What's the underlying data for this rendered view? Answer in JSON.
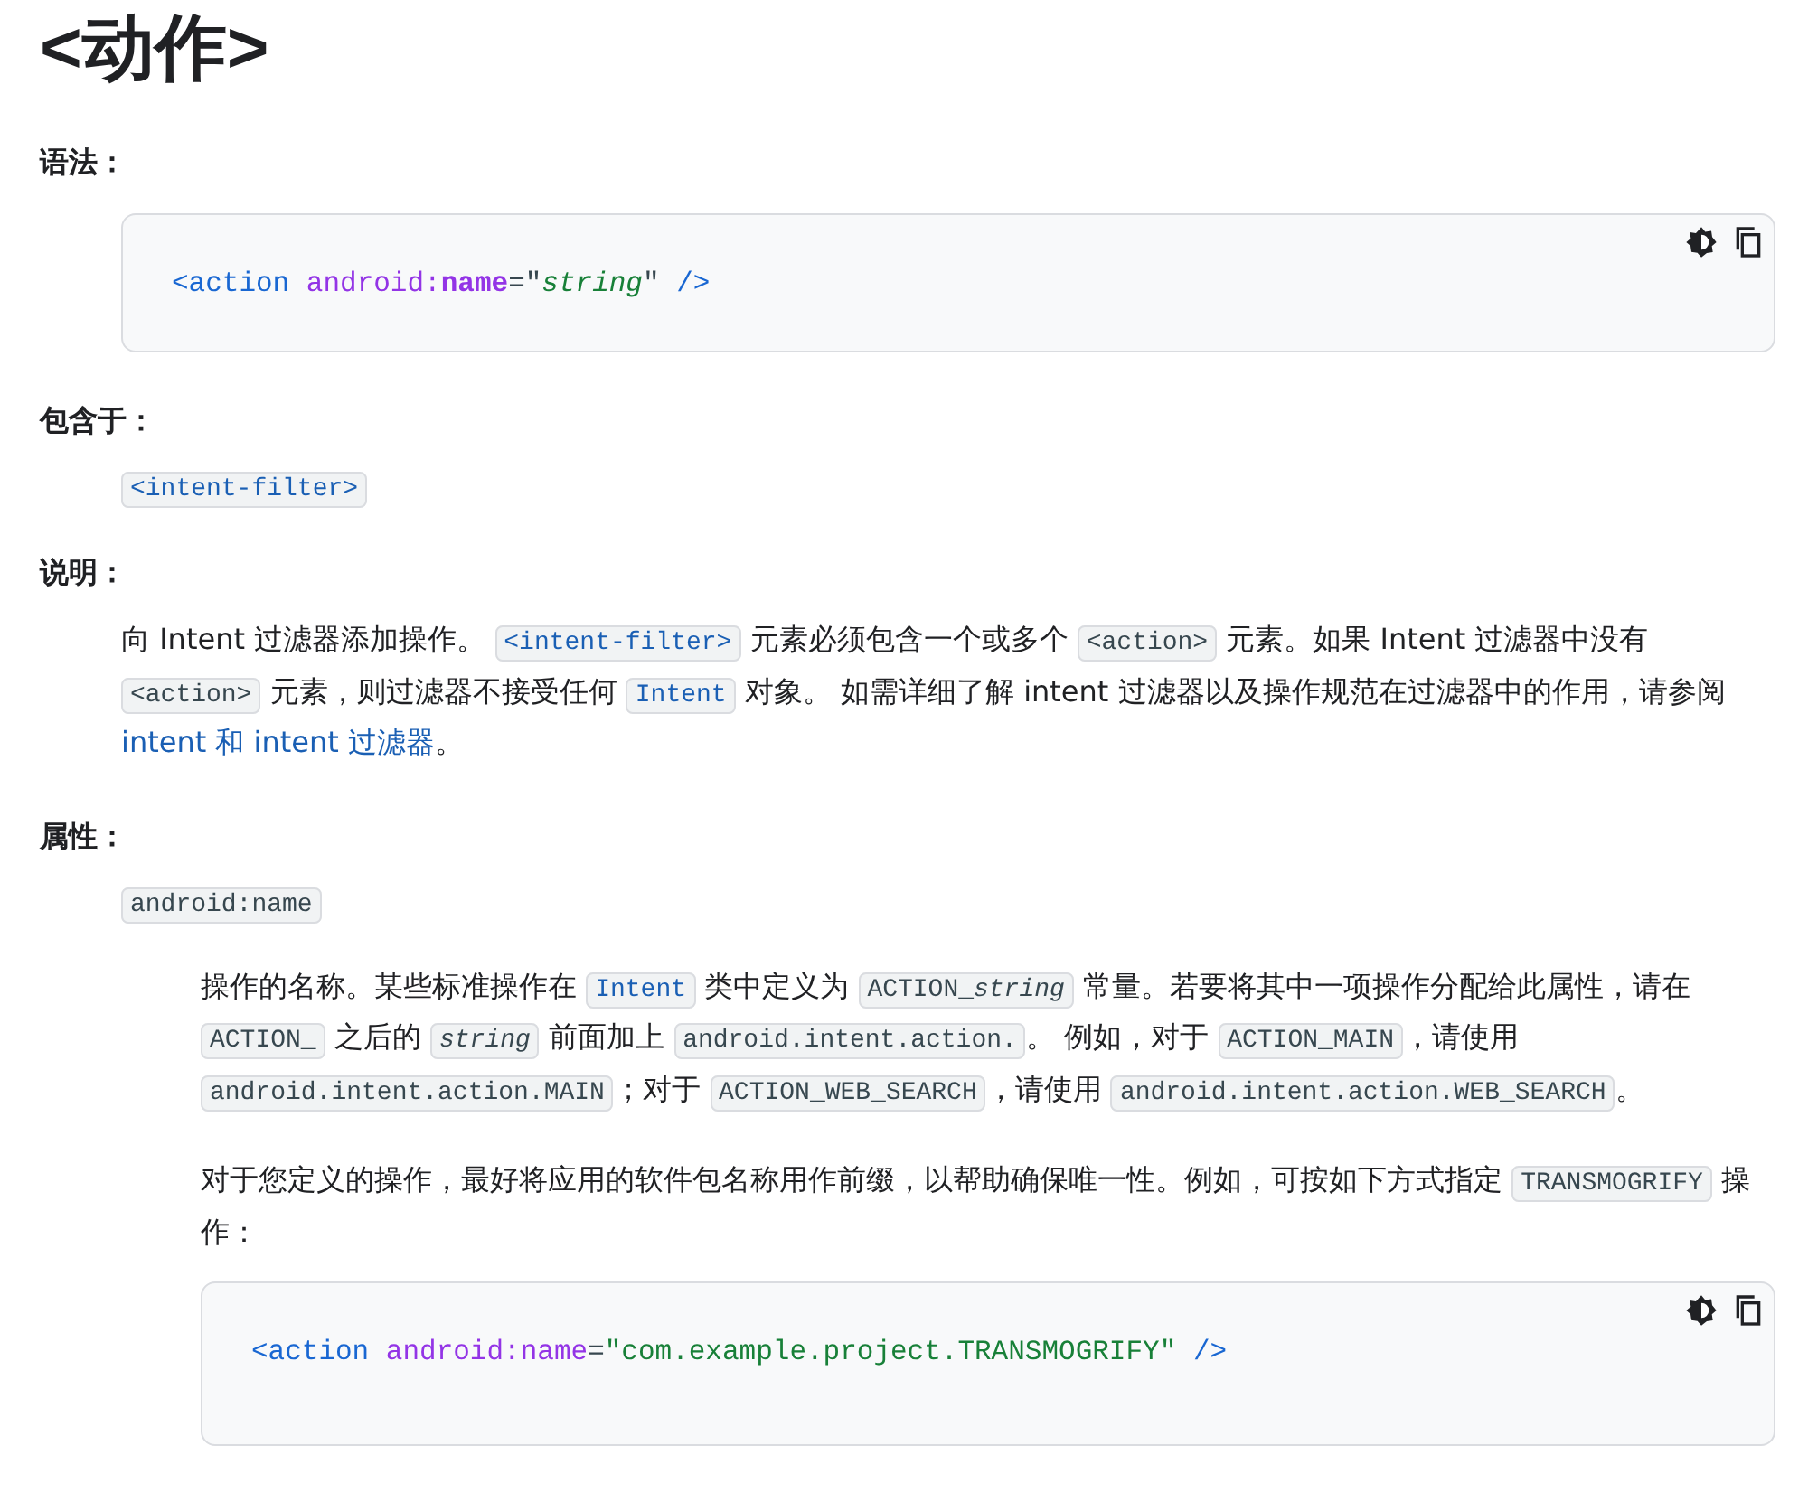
{
  "title": "<动作>",
  "sections": [
    {
      "label": "语法：",
      "blocks": [
        {
          "kind": "codeblock",
          "tokens": [
            {
              "kind": "tag",
              "text": "<action"
            },
            {
              "kind": "ns",
              "text": " android:"
            },
            {
              "kind": "attr",
              "text": "name"
            },
            {
              "kind": "plain",
              "text": "=\""
            },
            {
              "kind": "value_em",
              "text": "string"
            },
            {
              "kind": "plain",
              "text": "\""
            },
            {
              "kind": "tag",
              "text": " />"
            }
          ]
        }
      ]
    },
    {
      "label": "包含于：",
      "blocks": [
        {
          "kind": "chips",
          "items": [
            {
              "kind": "code_link",
              "text": "<intent-filter>"
            }
          ]
        }
      ]
    },
    {
      "label": "说明：",
      "blocks": [
        {
          "kind": "paragraph",
          "segments": [
            {
              "kind": "text",
              "text": "向 Intent 过滤器添加操作。 "
            },
            {
              "kind": "code_link",
              "text": "<intent-filter>"
            },
            {
              "kind": "text",
              "text": " 元素必须包含一个或多个 "
            },
            {
              "kind": "code",
              "text": "<action>"
            },
            {
              "kind": "text",
              "text": " 元素。如果 Intent 过滤器中没有 "
            },
            {
              "kind": "code",
              "text": "<action>"
            },
            {
              "kind": "text",
              "text": " 元素，则过滤器不接受任何 "
            },
            {
              "kind": "code_link",
              "text": "Intent"
            },
            {
              "kind": "text",
              "text": " 对象。 如需详细了解 intent 过滤器以及操作规范在过滤器中的作用，请参阅 "
            },
            {
              "kind": "link",
              "text": "intent 和 intent 过滤器"
            },
            {
              "kind": "text",
              "text": "。"
            }
          ]
        }
      ]
    },
    {
      "label": "属性：",
      "blocks": [
        {
          "kind": "chips",
          "items": [
            {
              "kind": "code",
              "text": "android:name"
            }
          ]
        },
        {
          "kind": "paragraph",
          "nested": true,
          "segments": [
            {
              "kind": "text",
              "text": "操作的名称。某些标准操作在 "
            },
            {
              "kind": "code_link",
              "text": "Intent"
            },
            {
              "kind": "text",
              "text": " 类中定义为 "
            },
            {
              "kind": "code",
              "text": "ACTION_",
              "em": "string"
            },
            {
              "kind": "text",
              "text": " 常量。若要将其中一项操作分配给此属性，请在 "
            },
            {
              "kind": "code",
              "text": "ACTION_"
            },
            {
              "kind": "text",
              "text": " 之后的 "
            },
            {
              "kind": "code_em",
              "text": "string"
            },
            {
              "kind": "text",
              "text": " 前面加上 "
            },
            {
              "kind": "code",
              "text": "android.intent.action."
            },
            {
              "kind": "text",
              "text": "。 例如，对于 "
            },
            {
              "kind": "code",
              "text": "ACTION_MAIN"
            },
            {
              "kind": "text",
              "text": "，请使用 "
            },
            {
              "kind": "code",
              "text": "android.intent.action.MAIN"
            },
            {
              "kind": "text",
              "text": "；对于 "
            },
            {
              "kind": "code",
              "text": "ACTION_WEB_SEARCH"
            },
            {
              "kind": "text",
              "text": "，请使用 "
            },
            {
              "kind": "code",
              "text": "android.intent.action.WEB_SEARCH"
            },
            {
              "kind": "text",
              "text": "。"
            }
          ]
        },
        {
          "kind": "paragraph",
          "nested": true,
          "segments": [
            {
              "kind": "text",
              "text": "对于您定义的操作，最好将应用的软件包名称用作前缀，以帮助确保唯一性。例如，可按如下方式指定 "
            },
            {
              "kind": "code",
              "text": "TRANSMOGRIFY"
            },
            {
              "kind": "text",
              "text": " 操作："
            }
          ]
        },
        {
          "kind": "codeblock",
          "nested": true,
          "tokens": [
            {
              "kind": "tag",
              "text": "<action"
            },
            {
              "kind": "ns",
              "text": " android:"
            },
            {
              "kind": "attr_plain",
              "text": "name"
            },
            {
              "kind": "plain",
              "text": "="
            },
            {
              "kind": "value",
              "text": "\"com.example.project.TRANSMOGRIFY\""
            },
            {
              "kind": "tag",
              "text": " />"
            }
          ]
        }
      ]
    }
  ]
}
